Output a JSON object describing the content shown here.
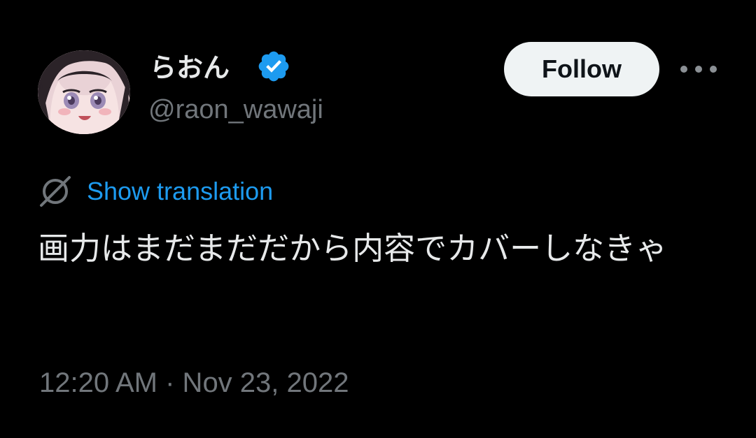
{
  "author": {
    "display_name": "らおん",
    "handle": "@raon_wawaji",
    "verified": true,
    "badge_color": "#1d9bf0"
  },
  "actions": {
    "follow_label": "Follow",
    "more_icon": "more-horizontal-icon"
  },
  "translation": {
    "icon": "globe-slash-icon",
    "link_label": "Show translation",
    "link_color": "#1d9bf0"
  },
  "tweet": {
    "text": "画力はまだまだだから内容でカバーしなきゃ",
    "timestamp": "12:20 AM · Nov 23, 2022"
  },
  "colors": {
    "background": "#000000",
    "primary_text": "#e7e9ea",
    "secondary_text": "#71767b",
    "follow_bg": "#eff3f4",
    "follow_text": "#0f1419"
  }
}
